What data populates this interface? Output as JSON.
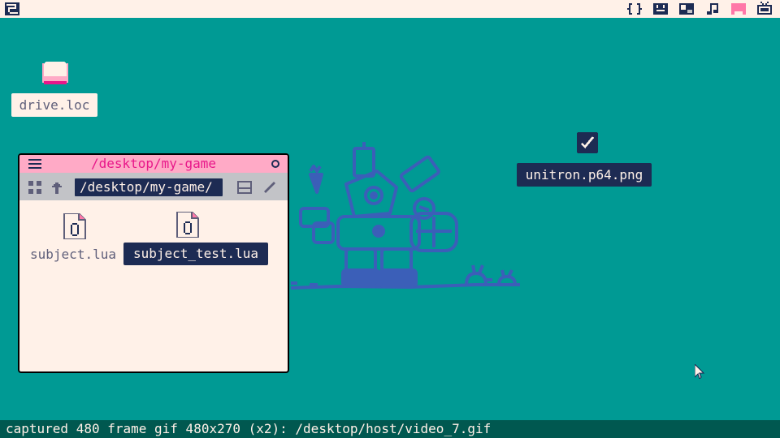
{
  "topbar": {
    "logo_icon": "picotron-logo-icon",
    "tool_icons": [
      "code-editor-icon",
      "sprite-editor-icon",
      "map-editor-icon",
      "sfx-editor-icon",
      "music-editor-icon",
      "game-run-icon"
    ]
  },
  "desktop": {
    "items": [
      {
        "label": "drive.loc",
        "icon": "drive-icon"
      },
      {
        "label": "unitron.p64.png",
        "icon": "checkbox-icon",
        "selected": true
      }
    ]
  },
  "window": {
    "title": "/desktop/my-game",
    "path": "/desktop/my-game/",
    "files": [
      {
        "label": "subject.lua",
        "selected": false
      },
      {
        "label": "subject_test.lua",
        "selected": true
      }
    ]
  },
  "statusbar": {
    "text": "captured 480 frame gif 480x270 (x2): /desktop/host/video_7.gif"
  },
  "colors": {
    "desktop": "#009a94",
    "titlebar": "#ffaac6",
    "title_text": "#e8178a",
    "panel": "#fff1e8",
    "dark": "#1d2b53",
    "toolbar": "#c2c3c7",
    "statusbar": "#005850",
    "accent_pink": "#ff77a8"
  }
}
